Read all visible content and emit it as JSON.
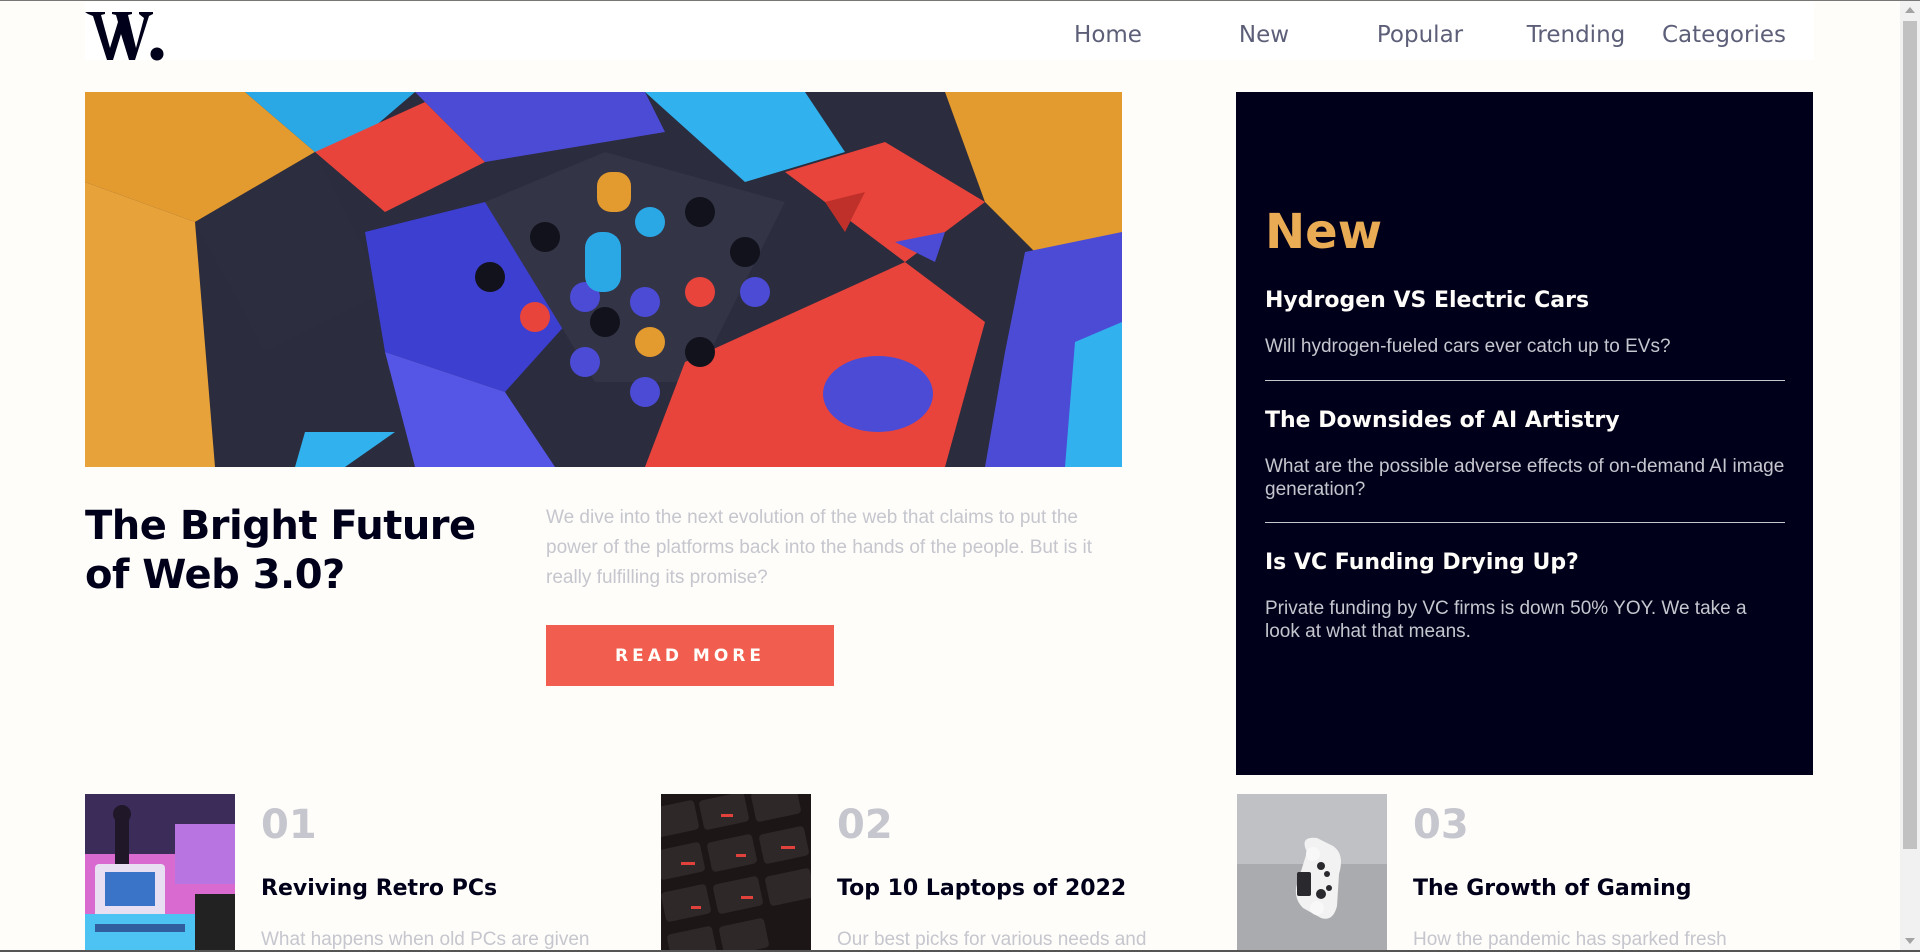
{
  "header": {
    "logo_alt": "W.",
    "nav": [
      {
        "label": "Home"
      },
      {
        "label": "New"
      },
      {
        "label": "Popular"
      },
      {
        "label": "Trending"
      },
      {
        "label": "Categories"
      }
    ]
  },
  "hero": {
    "title": "The Bright Future of Web 3.0?",
    "description": "We dive into the next evolution of the web that claims to put the power of the platforms back into the hands of the people. But is it really fulfilling its promise?",
    "button_label": "READ MORE"
  },
  "new_panel": {
    "heading": "New",
    "items": [
      {
        "title": "Hydrogen VS Electric Cars",
        "description": "Will hydrogen-fueled cars ever catch up to EVs?"
      },
      {
        "title": "The Downsides of AI Artistry",
        "description": "What are the possible adverse effects of on-demand AI image generation?"
      },
      {
        "title": "Is VC Funding Drying Up?",
        "description": "Private funding by VC firms is down 50% YOY. We take a look at what that means."
      }
    ]
  },
  "cards": [
    {
      "number": "01",
      "title": "Reviving Retro PCs",
      "description": "What happens when old PCs are given"
    },
    {
      "number": "02",
      "title": "Top 10 Laptops of 2022",
      "description": "Our best picks for various needs and"
    },
    {
      "number": "03",
      "title": "The Growth of Gaming",
      "description": "How the pandemic has sparked fresh"
    }
  ],
  "colors": {
    "accent": "#f15e50",
    "dark": "#00001a",
    "gold": "#e9ab53",
    "muted": "#c5c6ce",
    "background": "#fffdf9"
  }
}
